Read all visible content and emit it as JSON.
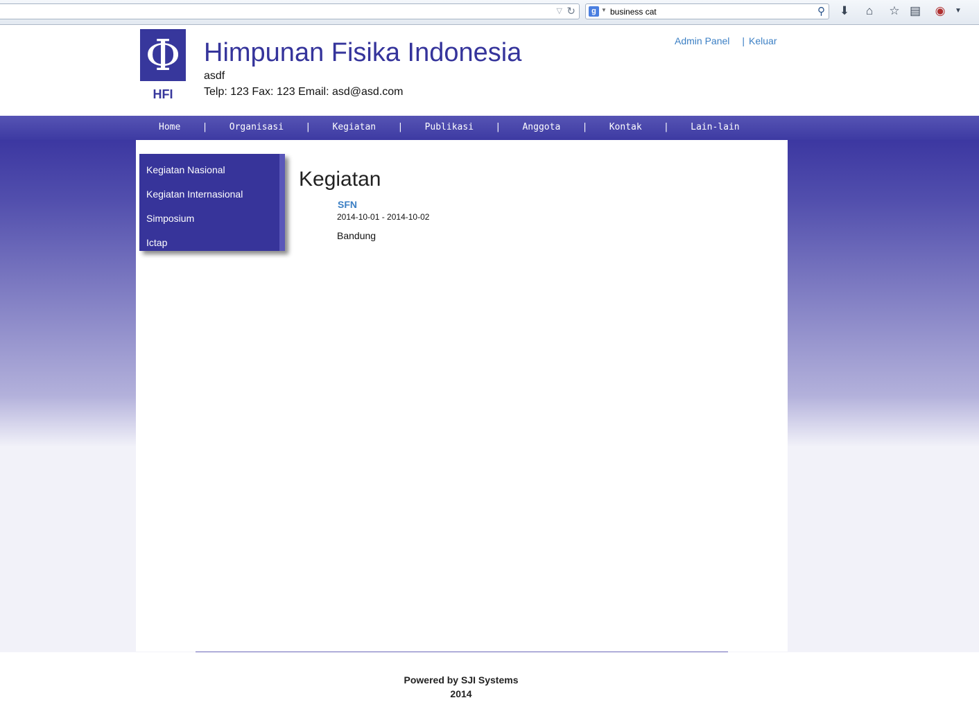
{
  "browser": {
    "search_engine_icon": "google-icon",
    "search_text": "business cat"
  },
  "header": {
    "logo_symbol": "Φ",
    "logo_text": "HFI",
    "title": "Himpunan Fisika Indonesia",
    "subtitle": "asdf",
    "contact": "Telp: 123 Fax: 123 Email: asd@asd.com",
    "admin_link": "Admin Panel",
    "separator": "|",
    "logout_link": "Keluar"
  },
  "nav": {
    "items": [
      "Home",
      "Organisasi",
      "Kegiatan",
      "Publikasi",
      "Anggota",
      "Kontak",
      "Lain-lain"
    ],
    "separator": "|"
  },
  "sidebar": {
    "items": [
      "Kegiatan Nasional",
      "Kegiatan Internasional",
      "Simposium",
      "Ictap"
    ]
  },
  "main": {
    "title": "Kegiatan",
    "event": {
      "name": "SFN",
      "date": "2014-10-01 - 2014-10-02",
      "place": "Bandung"
    }
  },
  "footer": {
    "powered": "Powered by SJI Systems",
    "year": "2014"
  },
  "colors": {
    "brand": "#37379c",
    "link": "#3b7fc4",
    "nav": "#4644aa"
  }
}
